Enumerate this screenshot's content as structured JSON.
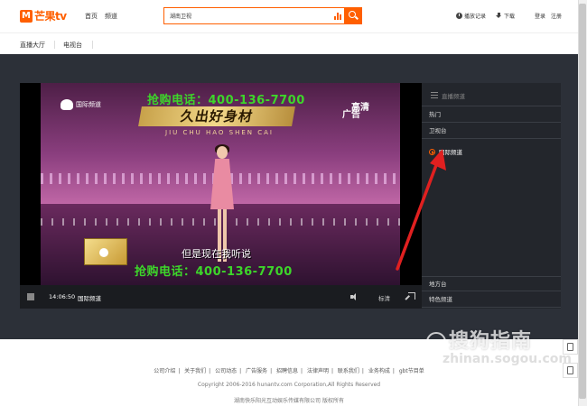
{
  "header": {
    "logo_text": "芒果tv",
    "nav": [
      "首页",
      "频道"
    ],
    "search": {
      "value": "湖南卫视"
    },
    "history_label": "播放记录",
    "download_label": "下载",
    "login_label": "登录",
    "register_label": "注册"
  },
  "subnav": {
    "tabs": [
      "直播大厅",
      "电视台"
    ],
    "active": "电视台"
  },
  "video": {
    "channel_logo_text": "国际频道",
    "phone_ad_top": "抢购电话：400-136-7700",
    "phone_ad_bottom": "抢购电话：400-136-7700",
    "subtitle": "但是现在我听说",
    "show_title": "久出好身材",
    "show_sub": "JIU CHU HAO SHEN CAI",
    "hd_badge": "高清",
    "ad_badge": "广告"
  },
  "controls": {
    "time": "14:06:50",
    "channel": "国际频道",
    "quality": "标清"
  },
  "panel": {
    "title": "直播频道",
    "categories": [
      "热门",
      "卫视台",
      "地方台",
      "特色频道"
    ],
    "active_channel": "国际频道"
  },
  "footer": {
    "links": [
      "公司介绍",
      "关于我们",
      "公司动态",
      "广告服务",
      "招聘信息",
      "法律声明",
      "联系我们",
      "业务构成",
      "gbt节目单"
    ],
    "copyright": "Copyright 2006-2016 hunantv.com Corporation,All Rights Reserved",
    "corp": "湖南快乐阳光互动娱乐传媒有限公司 版权所有"
  },
  "watermark": {
    "text": "搜狗指南",
    "url": "zhinan.sogou.com"
  },
  "colors": {
    "accent": "#ff5f00",
    "stage": "#2c3038",
    "ad_green": "#3dd62a",
    "arrow": "#e02020"
  }
}
